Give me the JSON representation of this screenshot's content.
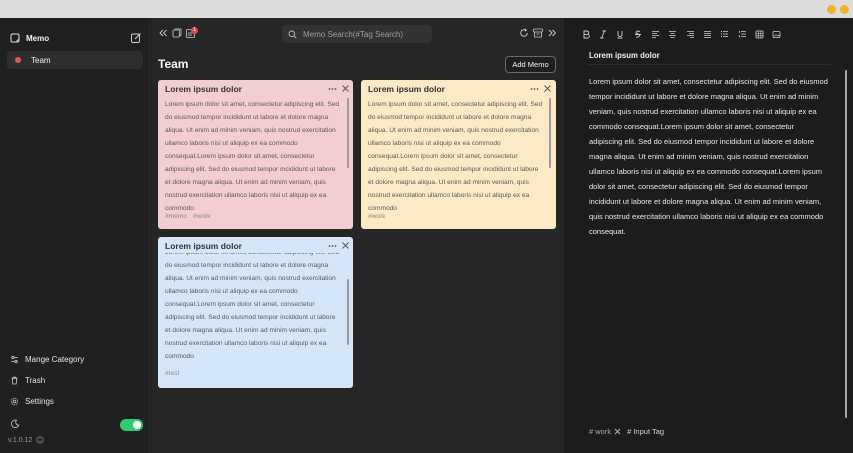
{
  "sidebar": {
    "brand": "Memo",
    "category": "Team",
    "links": [
      {
        "label": "Mange Category",
        "icon": "sliders-icon"
      },
      {
        "label": "Trash",
        "icon": "trash-icon"
      },
      {
        "label": "Settings",
        "icon": "gear-icon"
      }
    ],
    "dark_mode_on": true,
    "version": "v.1.0.12"
  },
  "toolbar": {
    "badge_count": "1",
    "search_placeholder": "Memo Search(#Tag Search)"
  },
  "main": {
    "title": "Team",
    "add_label": "Add Memo",
    "memos": [
      {
        "title": "Lorem ipsum dolor",
        "color": "#f2cdd2",
        "body": "Lorem ipsum dolor sit amet, consectetur adipiscing elit. Sed do eiusmod tempor incididunt ut labore et dolore magna aliqua. Ut enim ad minim veniam, quis nostrud exercitation ullamco laboris nisi ut aliquip ex ea commodo consequat.Lorem ipsum dolor sit amet, consectetur adipiscing elit. Sed do eiusmod tempor incididunt ut labore et dolore magna aliqua. Ut enim ad minim veniam, quis nostrud exercitation ullamco laboris nisi ut aliquip ex ea commodo",
        "tags": [
          "#memo",
          "#work"
        ]
      },
      {
        "title": "Lorem ipsum dolor",
        "color": "#fbeac4",
        "body": "Lorem ipsum dolor sit amet, consectetur adipiscing elit. Sed do eiusmod tempor incididunt ut labore et dolore magna aliqua. Ut enim ad minim veniam, quis nostrud exercitation ullamco laboris nisi ut aliquip ex ea commodo consequat.Lorem ipsum dolor sit amet, consectetur adipiscing elit. Sed do eiusmod tempor incididunt ut labore et dolore magna aliqua. Ut enim ad minim veniam, quis nostrud exercitation ullamco laboris nisi ut aliquip ex ea commodo",
        "tags": [
          "#work"
        ]
      },
      {
        "title": "Lorem ipsum dolor",
        "color": "#d6e6f9",
        "body": "Lorem ipsum dolor sit amet, consectetur adipiscing elit. Sed do eiusmod tempor incididunt ut labore et dolore magna aliqua. Ut enim ad minim veniam, quis nostrud exercitation ullamco laboris nisi ut aliquip ex ea commodo consequat.Lorem ipsum dolor sit amet, consectetur adipiscing elit. Sed do eiusmod tempor incididunt ut labore et dolore magna aliqua. Ut enim ad minim veniam, quis nostrud exercitation ullamco laboris nisi ut aliquip ex ea commodo",
        "tags": [
          "#test"
        ]
      }
    ]
  },
  "editor": {
    "title": "Lorem ipsum dolor",
    "body": "Lorem ipsum dolor sit amet, consectetur adipiscing elit. Sed do eiusmod tempor incididunt ut labore et dolore magna aliqua. Ut enim ad minim veniam, quis nostrud exercitation ullamco laboris nisi ut aliquip ex ea commodo consequat.Lorem ipsum dolor sit amet, consectetur adipiscing elit. Sed do eiusmod tempor incididunt ut labore et dolore magna aliqua. Ut enim ad minim veniam, quis nostrud exercitation ullamco laboris nisi ut aliquip ex ea commodo consequat.Lorem ipsum dolor sit amet, consectetur adipiscing elit. Sed do eiusmod tempor incididunt ut labore et dolore magna aliqua. Ut enim ad minim veniam, quis nostrud exercitation ullamco laboris nisi ut aliquip ex ea commodo consequat.",
    "tag": "# work",
    "tag_input": "# Input Tag",
    "format_buttons": [
      "bold-icon",
      "italic-icon",
      "underline-icon",
      "strikethrough-icon",
      "align-left-icon",
      "align-center-icon",
      "align-right-icon",
      "align-justify-icon",
      "bullet-list-icon",
      "numbered-list-icon",
      "table-icon",
      "image-icon"
    ]
  }
}
